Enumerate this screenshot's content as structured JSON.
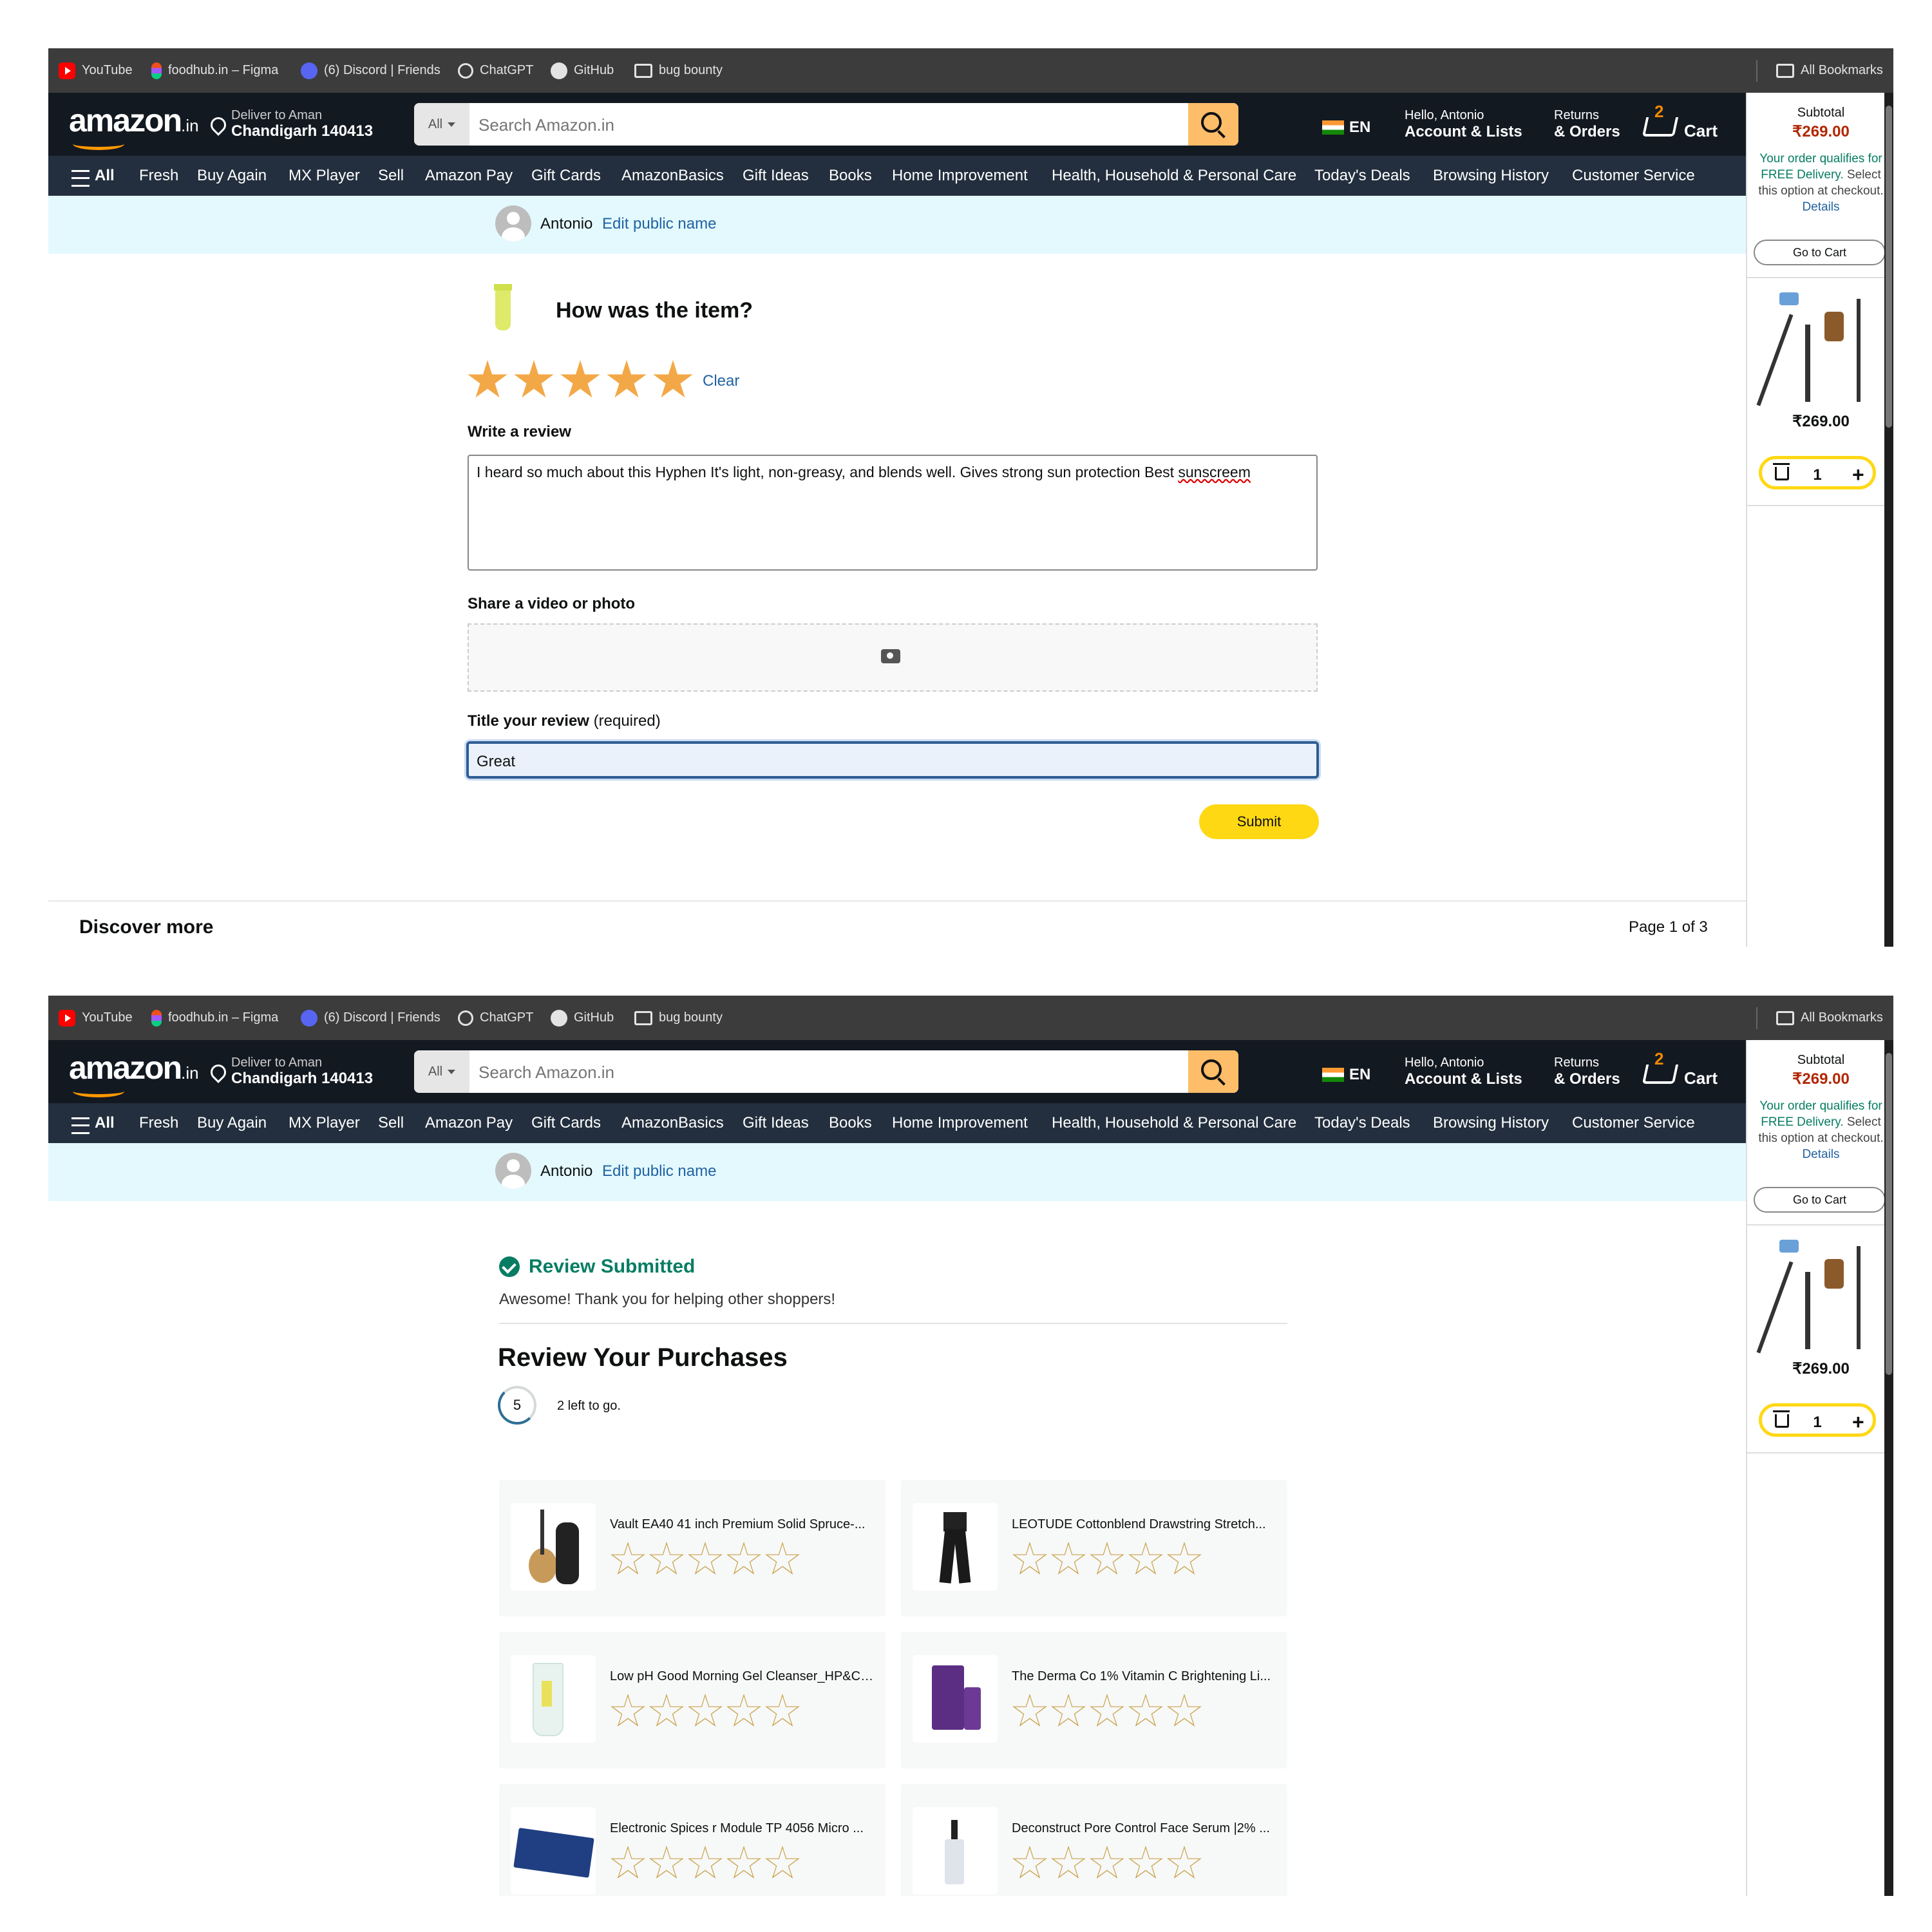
{
  "bookmarks": {
    "items": [
      "YouTube",
      "foodhub.in – Figma",
      "(6) Discord | Friends",
      "ChatGPT",
      "GitHub",
      "bug bounty"
    ],
    "all": "All Bookmarks"
  },
  "header": {
    "logo": "amazon",
    "logo_suffix": ".in",
    "deliver_to": "Deliver to Aman",
    "location": "Chandigarh 140413",
    "search_category": "All",
    "search_placeholder": "Search Amazon.in",
    "lang": "EN",
    "greeting": "Hello, Antonio",
    "account": "Account & Lists",
    "returns": "Returns",
    "orders": "& Orders",
    "cart_count": "2",
    "cart": "Cart"
  },
  "subnav": [
    "All",
    "Fresh",
    "Buy Again",
    "MX Player",
    "Sell",
    "Amazon Pay",
    "Gift Cards",
    "AmazonBasics",
    "Gift Ideas",
    "Books",
    "Home Improvement",
    "Health, Household & Personal Care",
    "Today's Deals",
    "Browsing History",
    "Customer Service"
  ],
  "profile": {
    "name": "Antonio",
    "edit": "Edit public name"
  },
  "review_form": {
    "question": "How was the item?",
    "rating": 5,
    "clear": "Clear",
    "write_label": "Write a review",
    "review_text_a": "I heard so much about this Hyphen It's light, non-greasy, and blends well. Gives strong sun protection Best ",
    "review_text_misspelled": "sunscreem",
    "share_label": "Share a video or photo",
    "title_label": "Title your review",
    "title_required": "(required)",
    "title_value": "Great",
    "submit": "Submit"
  },
  "discover": {
    "title": "Discover more",
    "page": "Page 1 of 3"
  },
  "cart_rail": {
    "subtotal_label": "Subtotal",
    "subtotal": "₹269.00",
    "note_green": "Your order qualifies for FREE Delivery.",
    "note": "Select this option at checkout.",
    "details": "Details",
    "go_to_cart": "Go to Cart",
    "item_price": "₹269.00",
    "qty": "1"
  },
  "submitted": {
    "title": "Review Submitted",
    "subtitle": "Awesome! Thank you for helping other shoppers!",
    "purchases_title": "Review Your Purchases",
    "progress": "5",
    "left_to_go": "2 left to go."
  },
  "purchases": [
    {
      "name": "Vault EA40 41 inch Premium Solid Spruce-...",
      "rating": 0
    },
    {
      "name": "LEOTUDE Cottonblend Drawstring Stretch...",
      "rating": 0
    },
    {
      "name": "Low pH Good Morning Gel Cleanser_HP&C ...",
      "rating": 0
    },
    {
      "name": "The Derma Co 1% Vitamin C Brightening Li...",
      "rating": 0
    },
    {
      "name": "Electronic Spices r Module TP 4056 Micro ...",
      "rating": 0
    },
    {
      "name": "Deconstruct Pore Control Face Serum |2% ...",
      "rating": 0
    }
  ],
  "colors": {
    "nav_dark": "#131921",
    "nav_sub": "#232f3e",
    "accent": "#ff9900",
    "submit_yellow": "#ffd814",
    "link_blue": "#2162a1",
    "price_red": "#b12704",
    "success_green": "#067d62"
  }
}
